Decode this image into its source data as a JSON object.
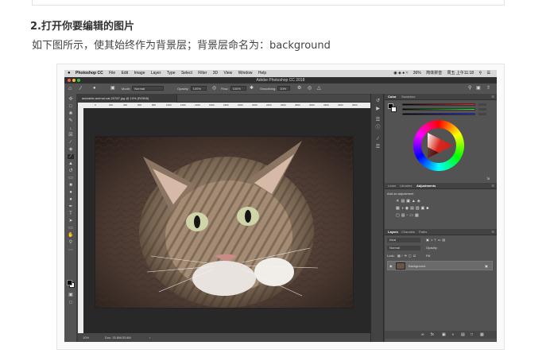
{
  "article": {
    "heading": "2.打开你要编辑的图片",
    "paragraph": "如下图所示，使其始终作为背景层；背景层命名为：background"
  },
  "mac_menubar": {
    "apple": "",
    "app_name": "Photoshop CC",
    "menus": [
      "File",
      "Edit",
      "Image",
      "Layer",
      "Type",
      "Select",
      "Filter",
      "3D",
      "View",
      "Window",
      "Help"
    ],
    "battery": "36%",
    "input_method": "简体拼音",
    "clock": "周五 上午11:18"
  },
  "window": {
    "title": "Adobe Photoshop CC 2018"
  },
  "options_bar": {
    "mode_label": "Mode:",
    "mode_value": "Normal",
    "opacity_label": "Opacity:",
    "opacity_value": "100%",
    "flow_label": "Flow:",
    "flow_value": "100%",
    "smoothing_label": "Smoothing:",
    "smoothing_value": "10%"
  },
  "document": {
    "tab_title": "adorable-animal-cat-20787.jpg @ 10% (RGB/8)",
    "ruler_ticks": [
      "0",
      "200",
      "400",
      "600",
      "800",
      "1000",
      "1200",
      "1400",
      "1600",
      "1800",
      "2000",
      "2200",
      "2400",
      "2600",
      "2800",
      "3000",
      "3200",
      "3400",
      "3600"
    ],
    "zoom": "10%",
    "doc_size": "Doc: 33.8M/33.8M"
  },
  "color_panel": {
    "tabs": [
      "Color",
      "Swatches"
    ],
    "active": "Color"
  },
  "adjustments_panel": {
    "tabs": [
      "Learn",
      "Libraries",
      "Adjustments"
    ],
    "active": "Adjustments",
    "hint": "Add an adjustment"
  },
  "layers_panel": {
    "tabs": [
      "Layers",
      "Channels",
      "Paths"
    ],
    "active": "Layers",
    "filter_label": "Kind",
    "blend_mode": "Normal",
    "opacity_label": "Opacity:",
    "lock_label": "Lock:",
    "fill_label": "Fill:",
    "layers": [
      {
        "name": "Background",
        "visible": true,
        "locked": true
      }
    ]
  },
  "colors": {
    "ps_dark": "#3c3c3c",
    "panel": "#535353",
    "accent_red": "#d9271e"
  },
  "icons": {
    "menu": "three-lines-icon",
    "eye": "eye-icon",
    "lock": "lock-icon"
  }
}
